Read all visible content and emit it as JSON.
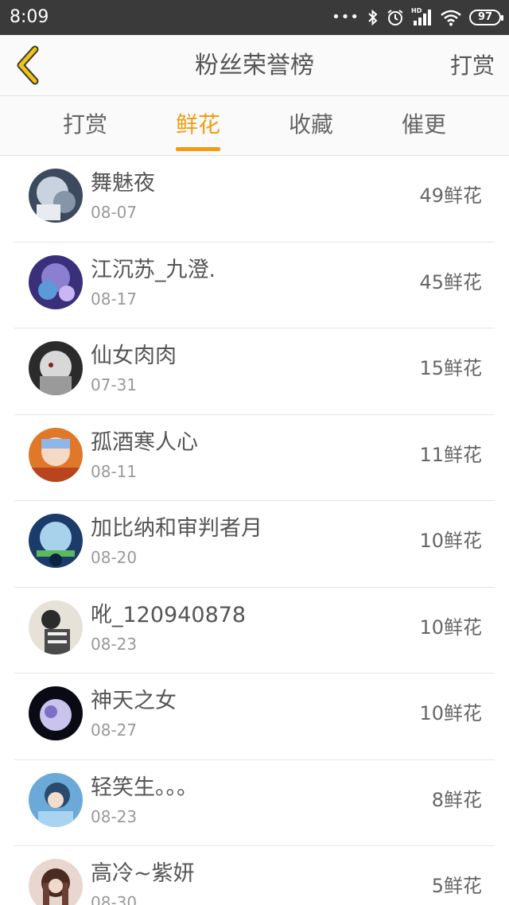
{
  "status_bar": {
    "time": "8:09",
    "dots": "•••",
    "hd": "HD",
    "battery": "97"
  },
  "header": {
    "back_icon": "chevron-left-icon",
    "title": "粉丝荣誉榜",
    "right_action": "打赏"
  },
  "tabs": [
    {
      "label": "打赏",
      "active": false
    },
    {
      "label": "鲜花",
      "active": true
    },
    {
      "label": "收藏",
      "active": false
    },
    {
      "label": "催更",
      "active": false
    }
  ],
  "accent_color": "#f39c12",
  "fans": [
    {
      "name": "舞魅夜",
      "date": "08-07",
      "value": "49鲜花"
    },
    {
      "name": "江沉苏_九澄.",
      "date": "08-17",
      "value": "45鲜花"
    },
    {
      "name": "仙女肉肉",
      "date": "07-31",
      "value": "15鲜花"
    },
    {
      "name": "孤酒寒人心",
      "date": "08-11",
      "value": "11鲜花"
    },
    {
      "name": "加比纳和审判者月",
      "date": "08-20",
      "value": "10鲜花"
    },
    {
      "name": "吪_120940878",
      "date": "08-23",
      "value": "10鲜花"
    },
    {
      "name": "神天之女",
      "date": "08-27",
      "value": "10鲜花"
    },
    {
      "name": "轻笑生。。。",
      "date": "08-23",
      "value": "8鲜花"
    },
    {
      "name": "高冷~紫妍",
      "date": "08-30",
      "value": "5鲜花"
    }
  ]
}
